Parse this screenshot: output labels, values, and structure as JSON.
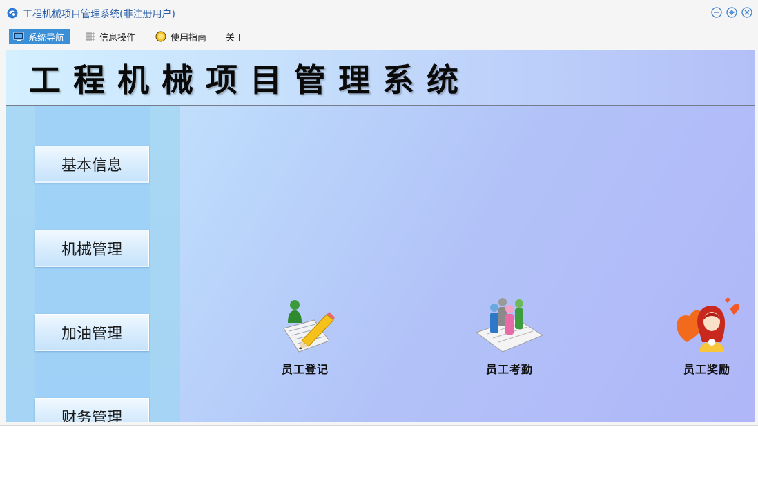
{
  "window": {
    "title": "工程机械项目管理系统(非注册用户)"
  },
  "menu": [
    {
      "label": "系统导航",
      "icon": "monitor-icon",
      "active": true
    },
    {
      "label": "信息操作",
      "icon": "grid-icon",
      "active": false
    },
    {
      "label": "使用指南",
      "icon": "help-icon",
      "active": false
    },
    {
      "label": "关于",
      "icon": "",
      "active": false
    }
  ],
  "banner": {
    "title": "工程机械项目管理系统"
  },
  "sidebar": {
    "items": [
      {
        "label": "基本信息"
      },
      {
        "label": "机械管理"
      },
      {
        "label": "加油管理"
      },
      {
        "label": "财务管理"
      }
    ]
  },
  "tiles": [
    {
      "label": "员工登记",
      "icon": "employee-register-icon"
    },
    {
      "label": "员工考勤",
      "icon": "employee-attendance-icon"
    },
    {
      "label": "员工奖励",
      "icon": "employee-reward-icon"
    }
  ],
  "colors": {
    "title_text": "#2a5fa8",
    "menu_active_bg": "#3a8fd6",
    "banner_border": "#777c8a"
  }
}
